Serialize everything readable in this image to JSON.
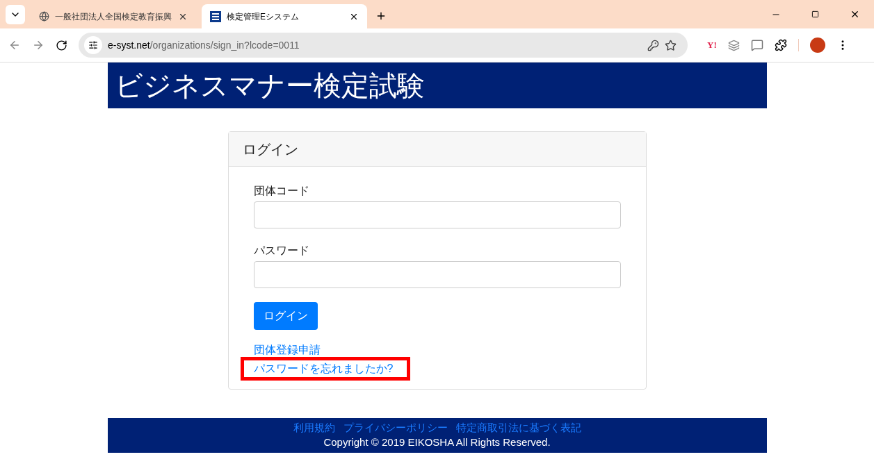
{
  "browser": {
    "tabs": [
      {
        "title": "一般社団法人全国検定教育振興",
        "selected": false,
        "kind": "globe"
      },
      {
        "title": "検定管理Eシステム",
        "selected": true,
        "kind": "site"
      }
    ],
    "address": {
      "domain": "e-syst.net",
      "path": "/organizations/sign_in?lcode=0011"
    },
    "extension_label": "Y!"
  },
  "header": {
    "title": "ビジネスマナー検定試験"
  },
  "login": {
    "heading": "ログイン",
    "fields": [
      {
        "label": "団体コード"
      },
      {
        "label": "パスワード"
      }
    ],
    "submit": "ログイン",
    "links": [
      {
        "text": "団体登録申請",
        "highlighted": false
      },
      {
        "text": "パスワードを忘れましたか?",
        "highlighted": true
      }
    ]
  },
  "footer": {
    "links": [
      "利用規約",
      "プライバシーポリシー",
      "特定商取引法に基づく表記"
    ],
    "copyright": "Copyright © 2019 EIKOSHA All Rights Reserved."
  }
}
